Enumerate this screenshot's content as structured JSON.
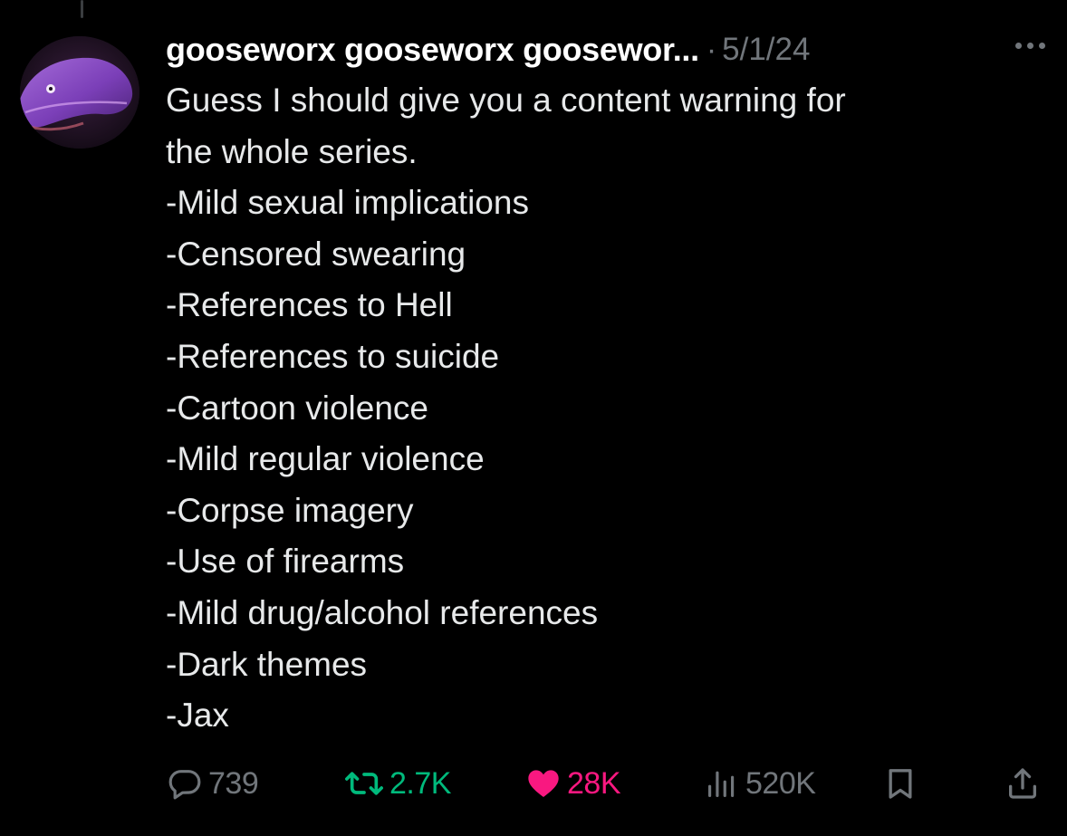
{
  "tweet": {
    "author": {
      "display_name": "gooseworx gooseworx goosewor...",
      "avatar": "purple-fish-avatar"
    },
    "separator": "·",
    "date": "5/1/24",
    "more_icon": "more-horizontal-icon",
    "text_lines": [
      "Guess I should give you a content warning for",
      "the whole series.",
      "-Mild sexual implications",
      "-Censored swearing",
      "-References to Hell",
      "-References to suicide",
      "-Cartoon violence",
      "-Mild regular violence",
      "-Corpse imagery",
      "-Use of firearms",
      "-Mild drug/alcohol references",
      "-Dark themes",
      "-Jax"
    ],
    "actions": {
      "replies": {
        "icon": "reply-icon",
        "count": "739"
      },
      "reposts": {
        "icon": "repost-icon",
        "count": "2.7K",
        "active": true
      },
      "likes": {
        "icon": "heart-icon",
        "count": "28K",
        "active": true
      },
      "views": {
        "icon": "views-icon",
        "count": "520K"
      },
      "bookmark": {
        "icon": "bookmark-icon"
      },
      "share": {
        "icon": "share-icon"
      }
    }
  },
  "colors": {
    "background": "#000000",
    "text_primary": "#e7e9ea",
    "text_secondary": "#71767b",
    "repost_active": "#00ba7c",
    "like_active": "#f91880"
  }
}
